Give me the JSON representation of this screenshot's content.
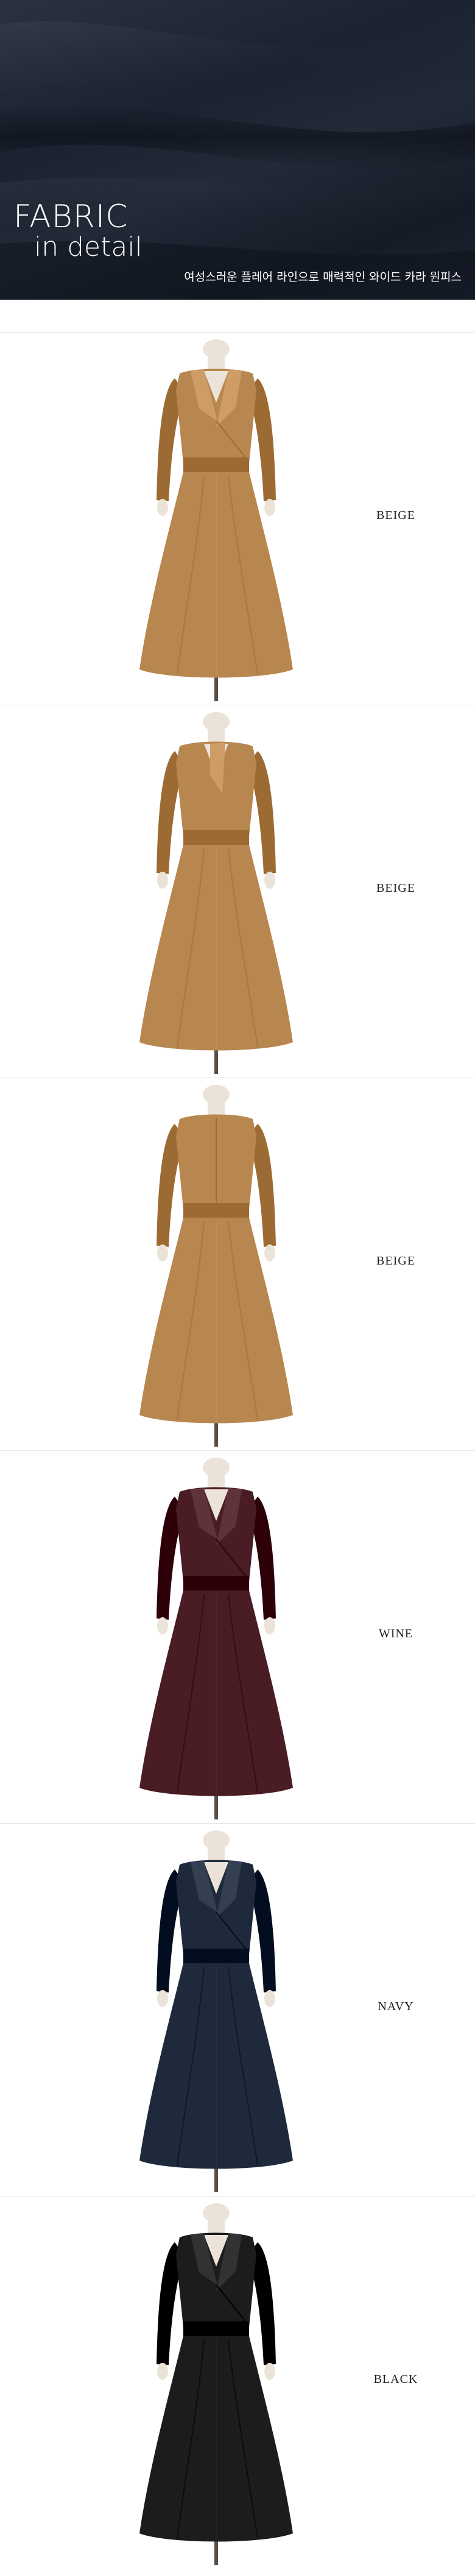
{
  "banner": {
    "title_line1": "FABRIC",
    "title_line2": "in detail",
    "caption": "여성스러운 플레어 라인으로 매력적인 와이드 카라 원피스",
    "fabric_color": "#1d2431"
  },
  "colors": [
    {
      "label": "BEIGE",
      "dress_color": "#b8874f",
      "view": "front"
    },
    {
      "label": "BEIGE",
      "dress_color": "#b8874f",
      "view": "side"
    },
    {
      "label": "BEIGE",
      "dress_color": "#b8874f",
      "view": "back"
    },
    {
      "label": "WINE",
      "dress_color": "#4a1c24",
      "view": "front"
    },
    {
      "label": "NAVY",
      "dress_color": "#1e2a3b",
      "view": "front"
    },
    {
      "label": "BLACK",
      "dress_color": "#1c1c1c",
      "view": "front"
    }
  ]
}
